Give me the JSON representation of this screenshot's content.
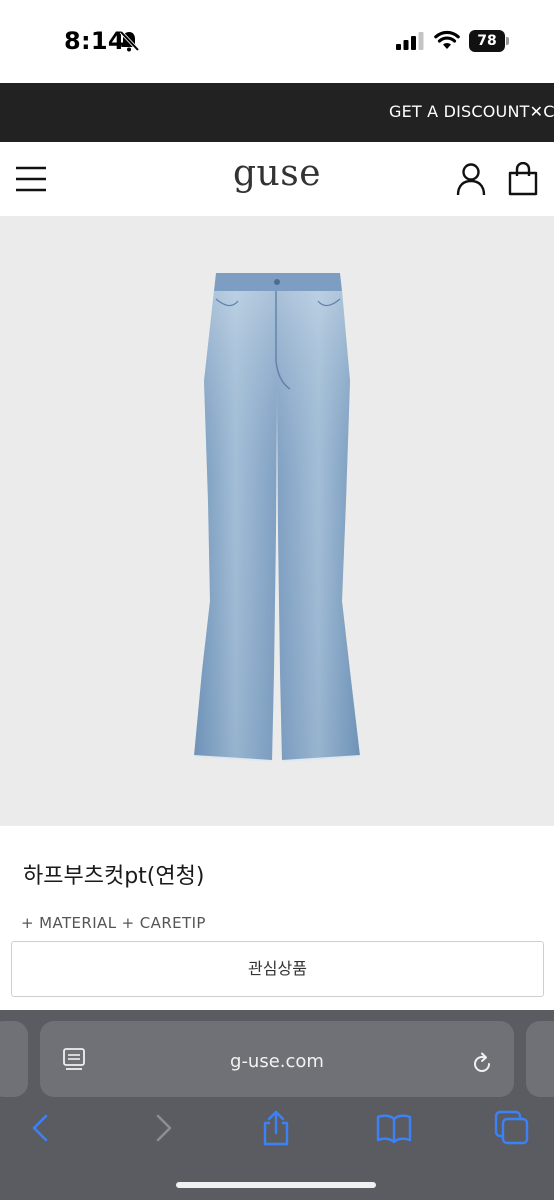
{
  "status_bar": {
    "time": "8:14",
    "battery": "78",
    "icons": [
      "bell-slash-icon",
      "cellular-signal-icon",
      "wifi-icon",
      "battery-icon"
    ]
  },
  "promo": {
    "text": "GET A DISCOUNT✕COUPON"
  },
  "header": {
    "logo": "guse",
    "icons": [
      "menu-icon",
      "user-icon",
      "shopping-bag-icon"
    ]
  },
  "product": {
    "image": "jeans-product-photo",
    "name": "하프부츠컷pt(연청)",
    "tags": "+ MATERIAL + CARETIP"
  },
  "wishlist": {
    "label": "관심상품"
  },
  "browser": {
    "url": "g-use.com",
    "icons": [
      "reader-mode-icon",
      "reload-icon",
      "back-icon",
      "forward-icon",
      "share-icon",
      "bookmarks-icon",
      "tabs-icon"
    ]
  },
  "colors": {
    "banner_bg": "#222222",
    "image_bg": "#ebebeb",
    "safari_bg": "#5a5c62",
    "safari_accent": "#3b82f6"
  }
}
